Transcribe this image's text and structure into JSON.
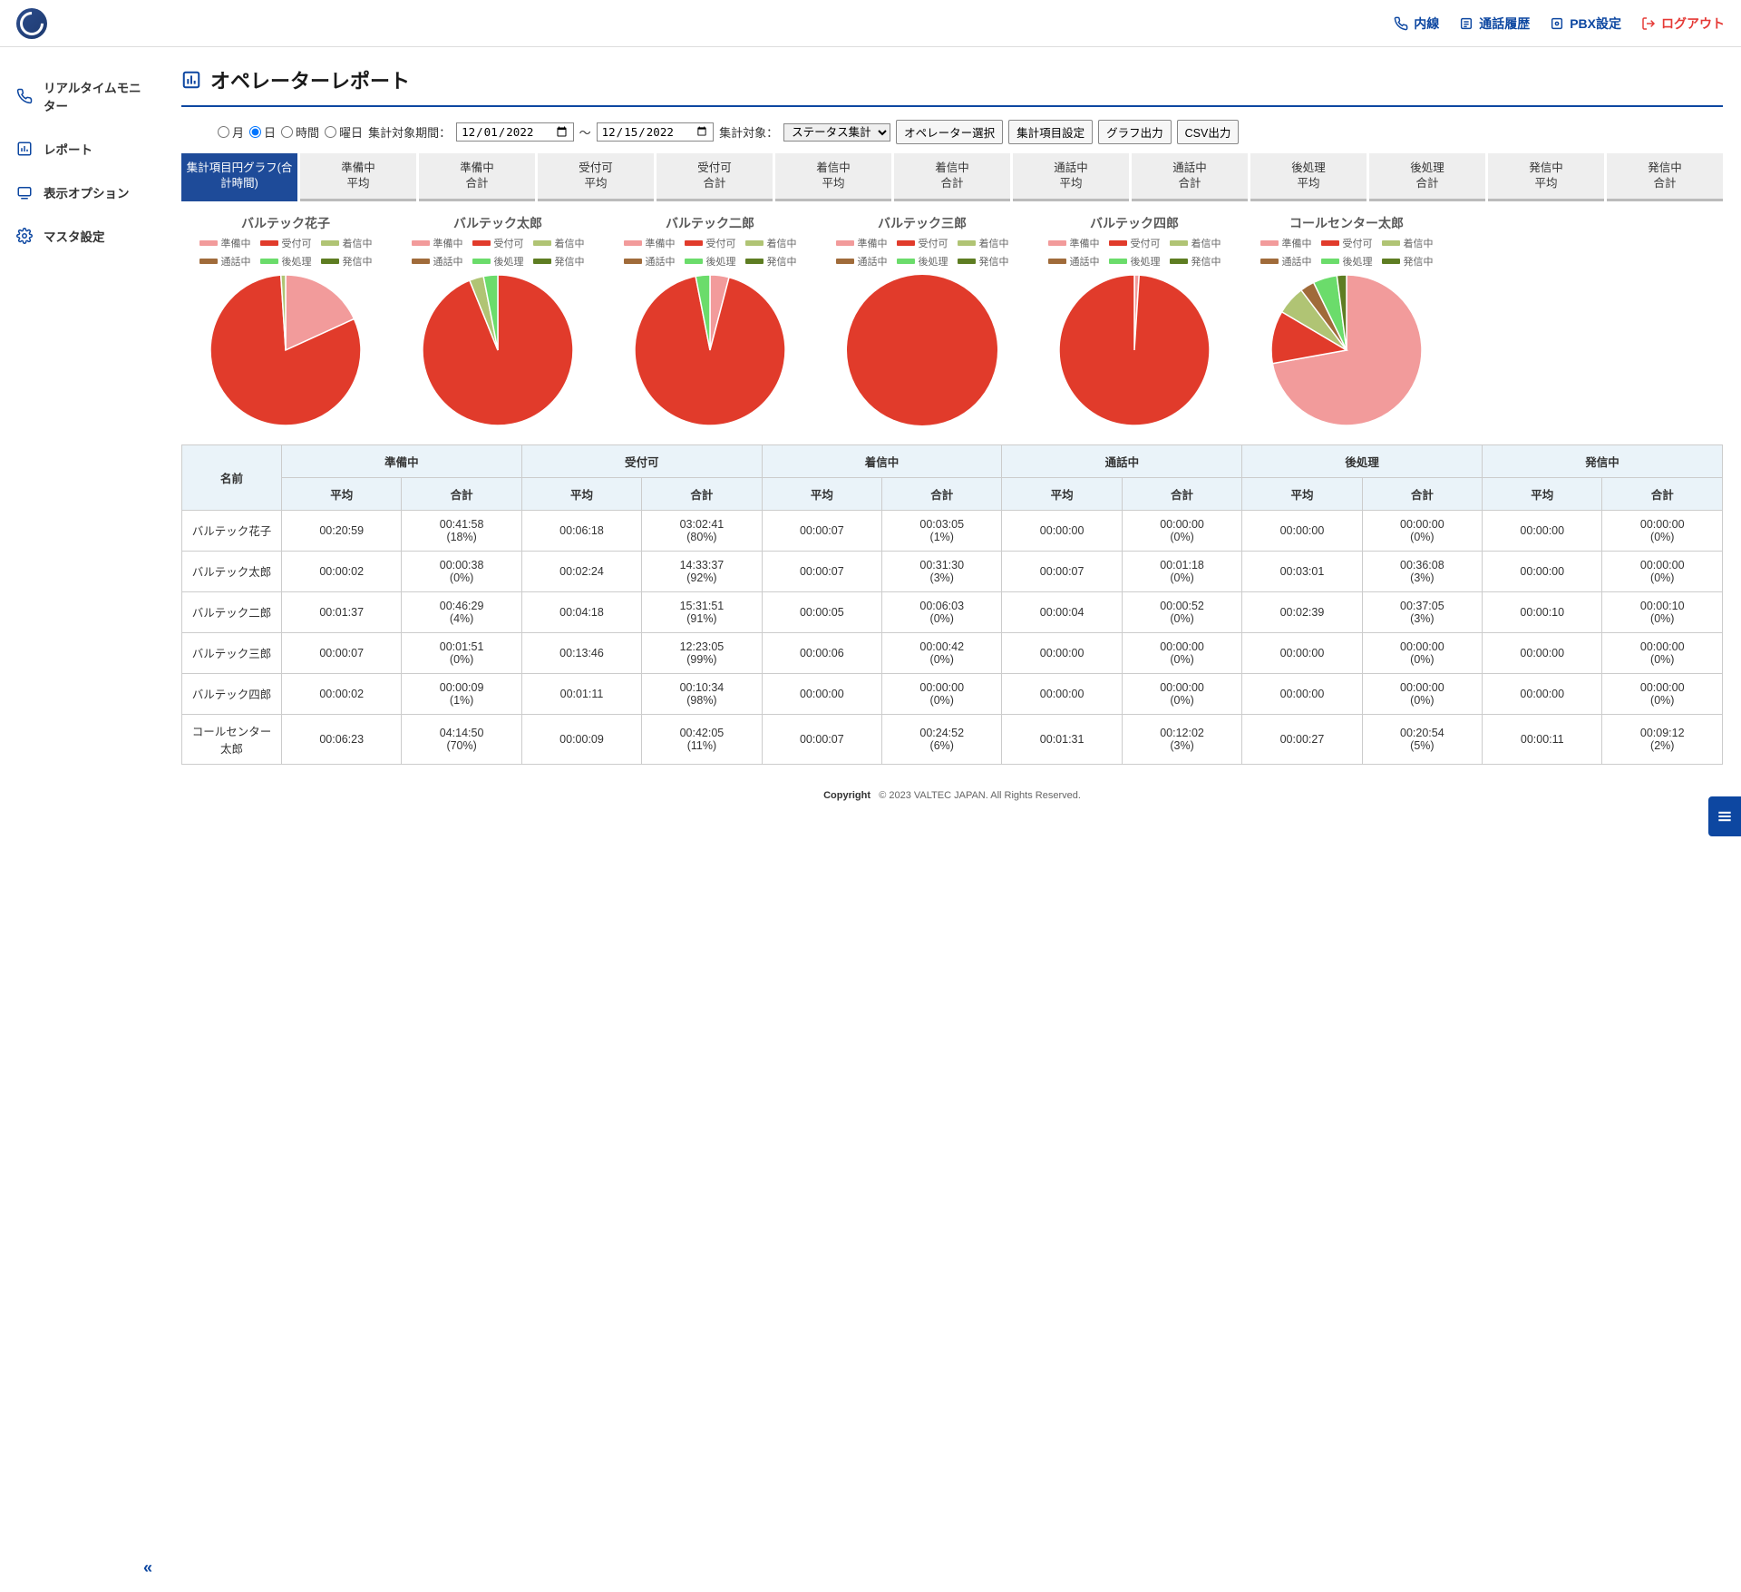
{
  "header": {
    "links": {
      "naisen": "内線",
      "history": "通話履歴",
      "pbx": "PBX設定",
      "logout": "ログアウト"
    }
  },
  "sidebar": {
    "items": [
      {
        "label": "リアルタイムモニター"
      },
      {
        "label": "レポート"
      },
      {
        "label": "表示オプション"
      },
      {
        "label": "マスタ設定"
      }
    ]
  },
  "page": {
    "title": "オペレーターレポート"
  },
  "controls": {
    "radios": {
      "month": "月",
      "day": "日",
      "hour": "時間",
      "weekday": "曜日"
    },
    "selected_radio": "day",
    "period_label": "集計対象期間：",
    "date_from": "2022/12/01",
    "date_to": "2022/12/15",
    "target_label": "集計対象：",
    "target_select": "ステータス集計",
    "buttons": {
      "op_select": "オペレーター選択",
      "item_set": "集計項目設定",
      "graph_out": "グラフ出力",
      "csv_out": "CSV出力"
    }
  },
  "tabs": [
    "集計項目円グラフ(合計時間)",
    "準備中\n平均",
    "準備中\n合計",
    "受付可\n平均",
    "受付可\n合計",
    "着信中\n平均",
    "着信中\n合計",
    "通話中\n平均",
    "通話中\n合計",
    "後処理\n平均",
    "後処理\n合計",
    "発信中\n平均",
    "発信中\n合計"
  ],
  "legend_labels": [
    "準備中",
    "受付可",
    "着信中",
    "通話中",
    "後処理",
    "発信中"
  ],
  "legend_colors": [
    "#f29b9b",
    "#e13b2b",
    "#b0c474",
    "#a06b3a",
    "#6bdc6b",
    "#5e7d22"
  ],
  "table": {
    "header_name": "名前",
    "group_headers": [
      "準備中",
      "受付可",
      "着信中",
      "通話中",
      "後処理",
      "発信中"
    ],
    "sub_headers": [
      "平均",
      "合計"
    ]
  },
  "operators": [
    {
      "name": "バルテック花子",
      "cells": [
        "00:20:59",
        "00:41:58\n(18%)",
        "00:06:18",
        "03:02:41\n(80%)",
        "00:00:07",
        "00:03:05\n(1%)",
        "00:00:00",
        "00:00:00\n(0%)",
        "00:00:00",
        "00:00:00\n(0%)",
        "00:00:00",
        "00:00:00\n(0%)"
      ],
      "pie": [
        18,
        80,
        1,
        0,
        0,
        0
      ]
    },
    {
      "name": "バルテック太郎",
      "cells": [
        "00:00:02",
        "00:00:38\n(0%)",
        "00:02:24",
        "14:33:37\n(92%)",
        "00:00:07",
        "00:31:30\n(3%)",
        "00:00:07",
        "00:01:18\n(0%)",
        "00:03:01",
        "00:36:08\n(3%)",
        "00:00:00",
        "00:00:00\n(0%)"
      ],
      "pie": [
        0,
        92,
        3,
        0,
        3,
        0
      ]
    },
    {
      "name": "バルテック二郎",
      "cells": [
        "00:01:37",
        "00:46:29\n(4%)",
        "00:04:18",
        "15:31:51\n(91%)",
        "00:00:05",
        "00:06:03\n(0%)",
        "00:00:04",
        "00:00:52\n(0%)",
        "00:02:39",
        "00:37:05\n(3%)",
        "00:00:10",
        "00:00:10\n(0%)"
      ],
      "pie": [
        4,
        91,
        0,
        0,
        3,
        0
      ]
    },
    {
      "name": "バルテック三郎",
      "cells": [
        "00:00:07",
        "00:01:51\n(0%)",
        "00:13:46",
        "12:23:05\n(99%)",
        "00:00:06",
        "00:00:42\n(0%)",
        "00:00:00",
        "00:00:00\n(0%)",
        "00:00:00",
        "00:00:00\n(0%)",
        "00:00:00",
        "00:00:00\n(0%)"
      ],
      "pie": [
        0,
        99,
        0,
        0,
        0,
        0
      ]
    },
    {
      "name": "バルテック四郎",
      "cells": [
        "00:00:02",
        "00:00:09\n(1%)",
        "00:01:11",
        "00:10:34\n(98%)",
        "00:00:00",
        "00:00:00\n(0%)",
        "00:00:00",
        "00:00:00\n(0%)",
        "00:00:00",
        "00:00:00\n(0%)",
        "00:00:00",
        "00:00:00\n(0%)"
      ],
      "pie": [
        1,
        98,
        0,
        0,
        0,
        0
      ]
    },
    {
      "name": "コールセンター太郎",
      "cells": [
        "00:06:23",
        "04:14:50\n(70%)",
        "00:00:09",
        "00:42:05\n(11%)",
        "00:00:07",
        "00:24:52\n(6%)",
        "00:01:31",
        "00:12:02\n(3%)",
        "00:00:27",
        "00:20:54\n(5%)",
        "00:00:11",
        "00:09:12\n(2%)"
      ],
      "pie": [
        70,
        11,
        6,
        3,
        5,
        2
      ]
    }
  ],
  "copyright": {
    "label": "Copyright",
    "text": "© 2023 VALTEC JAPAN. All Rights Reserved."
  },
  "chart_data": {
    "type": "pie",
    "note": "One pie per operator; values are percentages of total time per status.",
    "categories": [
      "準備中",
      "受付可",
      "着信中",
      "通話中",
      "後処理",
      "発信中"
    ],
    "series": [
      {
        "name": "バルテック花子",
        "values": [
          18,
          80,
          1,
          0,
          0,
          0
        ]
      },
      {
        "name": "バルテック太郎",
        "values": [
          0,
          92,
          3,
          0,
          3,
          0
        ]
      },
      {
        "name": "バルテック二郎",
        "values": [
          4,
          91,
          0,
          0,
          3,
          0
        ]
      },
      {
        "name": "バルテック三郎",
        "values": [
          0,
          99,
          0,
          0,
          0,
          0
        ]
      },
      {
        "name": "バルテック四郎",
        "values": [
          1,
          98,
          0,
          0,
          0,
          0
        ]
      },
      {
        "name": "コールセンター太郎",
        "values": [
          70,
          11,
          6,
          3,
          5,
          2
        ]
      }
    ],
    "colors": [
      "#f29b9b",
      "#e13b2b",
      "#b0c474",
      "#a06b3a",
      "#6bdc6b",
      "#5e7d22"
    ]
  }
}
